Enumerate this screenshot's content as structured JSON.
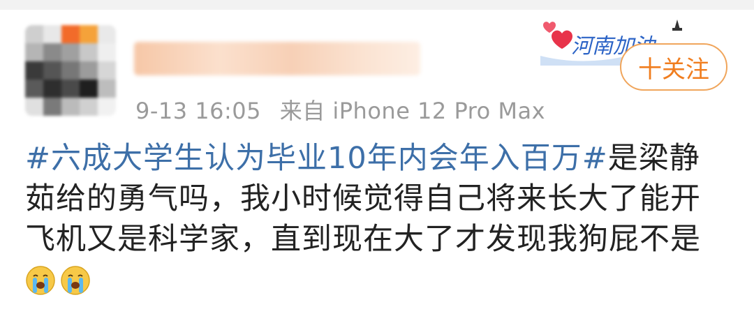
{
  "badge": {
    "text": "河南加油"
  },
  "follow": {
    "label": "十关注"
  },
  "post": {
    "time": "9-13 16:05",
    "source": "来自 iPhone 12 Pro Max",
    "hashtag": "#六成大学生认为毕业10年内会年入百万#",
    "line1_rest": "是梁静",
    "line2": "茹给的勇气吗，我小时候觉得自己将来长大了能开",
    "line3": "飞机又是科学家，直到现在大了才发现我狗屁不是",
    "emojis": [
      "crying-face",
      "crying-face"
    ]
  },
  "colors": {
    "hashtag": "#3d6fa8",
    "follow_border": "#f0a55b",
    "follow_text": "#f07d1e",
    "meta": "#9a9a9a"
  }
}
